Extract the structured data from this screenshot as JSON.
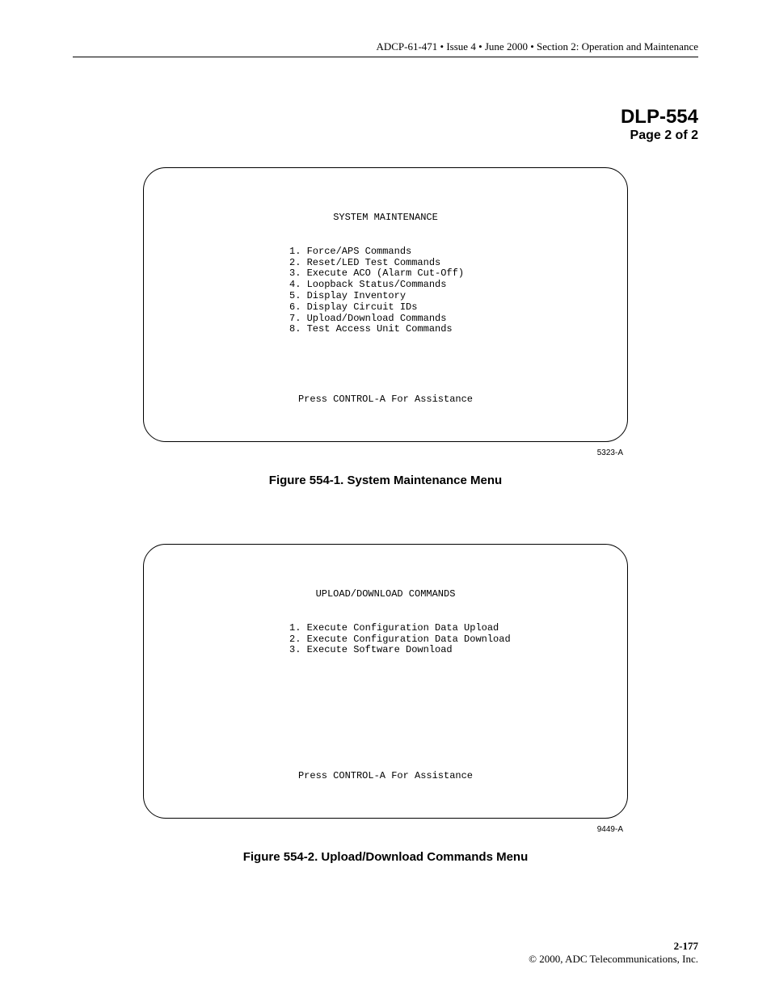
{
  "header": "ADCP-61-471 • Issue 4 • June 2000 • Section 2: Operation and Maintenance",
  "doc_id": "DLP-554",
  "page_of": "Page 2 of 2",
  "figure1": {
    "terminal_title": "SYSTEM MAINTENANCE",
    "items": [
      "1. Force/APS Commands",
      "2. Reset/LED Test Commands",
      "3. Execute ACO (Alarm Cut-Off)",
      "4. Loopback Status/Commands",
      "5. Display Inventory",
      "6. Display Circuit IDs",
      "7. Upload/Download Commands",
      "8. Test Access Unit Commands"
    ],
    "footer_hint": "Press CONTROL-A For Assistance",
    "fig_id": "5323-A",
    "caption": "Figure 554-1. System Maintenance Menu"
  },
  "figure2": {
    "terminal_title": "UPLOAD/DOWNLOAD COMMANDS",
    "items": [
      "1. Execute Configuration Data Upload",
      "2. Execute Configuration Data Download",
      "3. Execute Software Download"
    ],
    "footer_hint": "Press CONTROL-A For Assistance",
    "fig_id": "9449-A",
    "caption": "Figure 554-2. Upload/Download Commands Menu"
  },
  "footer": {
    "page_num": "2-177",
    "copyright": "© 2000, ADC Telecommunications, Inc."
  }
}
